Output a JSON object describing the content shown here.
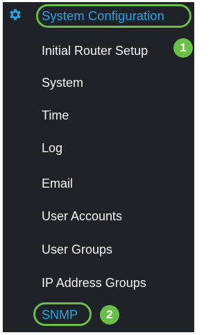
{
  "section": {
    "label": "System Configuration",
    "icon": "gear-icon"
  },
  "menu": {
    "items": [
      {
        "label": "Initial Router Setup"
      },
      {
        "label": "System"
      },
      {
        "label": "Time"
      },
      {
        "label": "Log"
      },
      {
        "label": "Email"
      },
      {
        "label": "User Accounts"
      },
      {
        "label": "User Groups"
      },
      {
        "label": "IP Address Groups"
      },
      {
        "label": "SNMP"
      }
    ]
  },
  "callouts": {
    "step1": "1",
    "step2": "2"
  },
  "colors": {
    "panel_bg": "#1f2227",
    "accent_blue": "#2aa3e6",
    "highlight_green": "#6abf4b",
    "text": "#f4f4f4"
  }
}
